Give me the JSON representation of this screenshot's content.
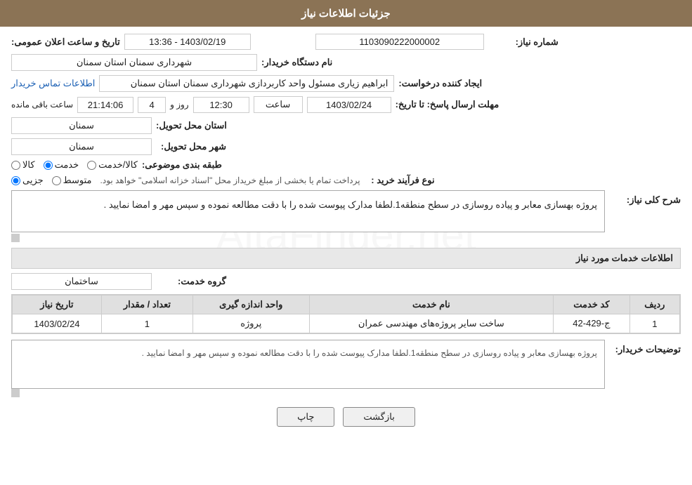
{
  "header": {
    "title": "جزئیات اطلاعات نیاز"
  },
  "form": {
    "request_number_label": "شماره نیاز:",
    "request_number_value": "1103090222000002",
    "date_label": "تاریخ و ساعت اعلان عمومی:",
    "date_value": "1403/02/19 - 13:36",
    "requester_org_label": "نام دستگاه خریدار:",
    "requester_org_value": "شهرداری سمنان استان سمنان",
    "creator_label": "ایجاد کننده درخواست:",
    "creator_value": "ابراهیم زیاری مسئول واحد کاربردازی شهرداری سمنان استان سمنان",
    "contact_link": "اطلاعات تماس خریدار",
    "deadline_label": "مهلت ارسال پاسخ: تا تاریخ:",
    "deadline_date": "1403/02/24",
    "deadline_time_label": "ساعت",
    "deadline_time_value": "12:30",
    "deadline_day_label": "روز و",
    "deadline_day_value": "4",
    "deadline_remaining_label": "ساعت باقی مانده",
    "deadline_remaining_value": "21:14:06",
    "province_label": "استان محل تحویل:",
    "province_value": "سمنان",
    "city_label": "شهر محل تحویل:",
    "city_value": "سمنان",
    "category_label": "طبقه بندی موضوعی:",
    "category_radio": [
      "کالا",
      "خدمت",
      "کالا/خدمت"
    ],
    "category_selected": "خدمت",
    "purchase_type_label": "نوع فرآیند خرید :",
    "purchase_radio": [
      "جزیی",
      "متوسط"
    ],
    "purchase_note": "پرداخت تمام یا بخشی از مبلغ خریداز محل \"اسناد خزانه اسلامی\" خواهد بود.",
    "description_section_label": "شرح کلی نیاز:",
    "description_text": "پروژه بهسازی معابر و پیاده روسازی در سطح منطقه1.لطفا مدارک پیوست شده را با دقت مطالعه نموده و سپس مهر و امضا نمایید .",
    "services_section_title": "اطلاعات خدمات مورد نیاز",
    "service_group_label": "گروه خدمت:",
    "service_group_value": "ساختمان",
    "table": {
      "headers": [
        "ردیف",
        "کد خدمت",
        "نام خدمت",
        "واحد اندازه گیری",
        "تعداد / مقدار",
        "تاریخ نیاز"
      ],
      "rows": [
        [
          "1",
          "ج-429-42",
          "ساخت سایر پروژه‌های مهندسی عمران",
          "پروژه",
          "1",
          "1403/02/24"
        ]
      ]
    },
    "buyer_desc_label": "توضیحات خریدار:",
    "buyer_desc_text": "پروژه بهسازی معابر و پیاده روسازی در سطح منطقه1.لطفا مدارک پیوست شده را با دقت مطالعه نموده و سپس مهر و امضا نمایید ."
  },
  "buttons": {
    "print": "چاپ",
    "back": "بازگشت"
  }
}
